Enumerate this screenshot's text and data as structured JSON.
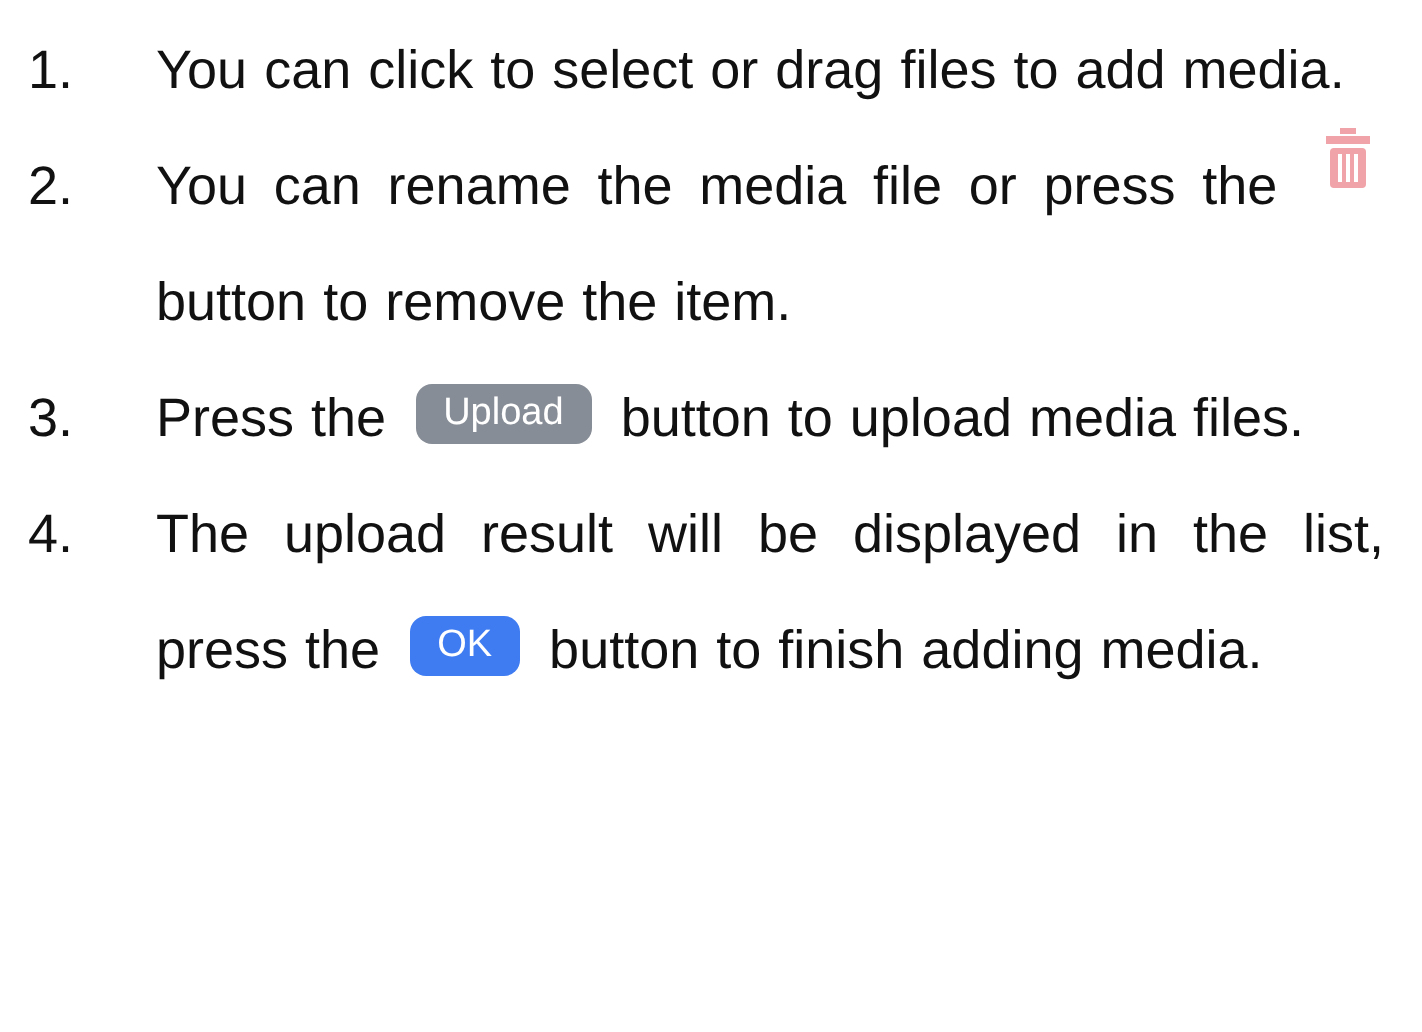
{
  "steps": [
    {
      "number": "1.",
      "parts": [
        {
          "kind": "text",
          "text": "You can click to select or drag files to add media."
        }
      ]
    },
    {
      "number": "2.",
      "parts": [
        {
          "kind": "text",
          "text": "You can rename the media file or press the"
        },
        {
          "kind": "trash"
        },
        {
          "kind": "text",
          "text": "button to remove the item."
        }
      ]
    },
    {
      "number": "3.",
      "parts": [
        {
          "kind": "text",
          "text": "Press the"
        },
        {
          "kind": "button",
          "text": "Upload",
          "color": "#878d96"
        },
        {
          "kind": "text",
          "text": "button to upload media files."
        }
      ]
    },
    {
      "number": "4.",
      "parts": [
        {
          "kind": "text",
          "text": "The upload result will be displayed in the list, press the"
        },
        {
          "kind": "button",
          "text": "OK",
          "color": "#3f7cf2"
        },
        {
          "kind": "text",
          "text": "button to finish adding media."
        }
      ]
    }
  ]
}
